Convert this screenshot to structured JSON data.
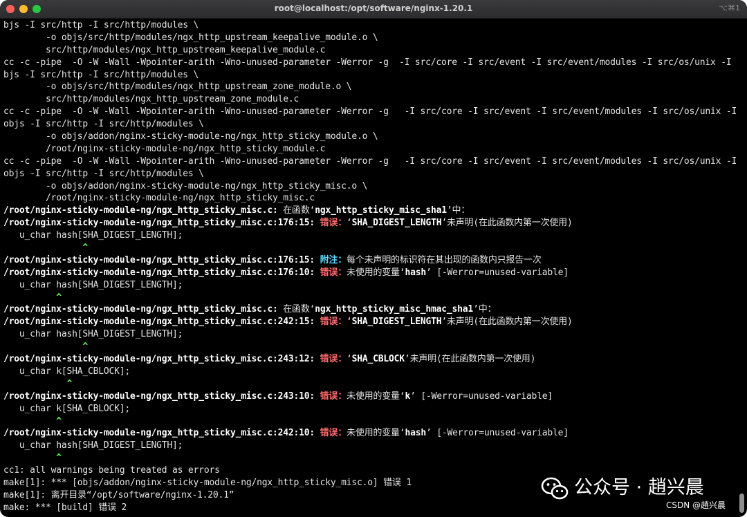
{
  "window": {
    "title": "root@localhost:/opt/software/nginx-1.20.1",
    "shortcut": "⌥⌘1"
  },
  "terminal": {
    "lines": [
      [
        {
          "t": "bjs -I src/http -I src/http/modules \\"
        }
      ],
      [
        {
          "t": "        -o objs/src/http/modules/ngx_http_upstream_keepalive_module.o \\"
        }
      ],
      [
        {
          "t": "        src/http/modules/ngx_http_upstream_keepalive_module.c"
        }
      ],
      [
        {
          "t": "cc -c -pipe  -O -W -Wall -Wpointer-arith -Wno-unused-parameter -Werror -g  -I src/core -I src/event -I src/event/modules -I src/os/unix -I o"
        }
      ],
      [
        {
          "t": "bjs -I src/http -I src/http/modules \\"
        }
      ],
      [
        {
          "t": "        -o objs/src/http/modules/ngx_http_upstream_zone_module.o \\"
        }
      ],
      [
        {
          "t": "        src/http/modules/ngx_http_upstream_zone_module.c"
        }
      ],
      [
        {
          "t": "cc -c -pipe  -O -W -Wall -Wpointer-arith -Wno-unused-parameter -Werror -g   -I src/core -I src/event -I src/event/modules -I src/os/unix -I"
        }
      ],
      [
        {
          "t": "objs -I src/http -I src/http/modules \\"
        }
      ],
      [
        {
          "t": "        -o objs/addon/nginx-sticky-module-ng/ngx_http_sticky_module.o \\"
        }
      ],
      [
        {
          "t": "        /root/nginx-sticky-module-ng/ngx_http_sticky_module.c"
        }
      ],
      [
        {
          "t": "cc -c -pipe  -O -W -Wall -Wpointer-arith -Wno-unused-parameter -Werror -g   -I src/core -I src/event -I src/event/modules -I src/os/unix -I"
        }
      ],
      [
        {
          "t": "objs -I src/http -I src/http/modules \\"
        }
      ],
      [
        {
          "t": "        -o objs/addon/nginx-sticky-module-ng/ngx_http_sticky_misc.o \\"
        }
      ],
      [
        {
          "t": "        /root/nginx-sticky-module-ng/ngx_http_sticky_misc.c"
        }
      ],
      [
        {
          "t": "/root/nginx-sticky-module-ng/ngx_http_sticky_misc.c:",
          "s": "b"
        },
        {
          "t": " 在函数‘"
        },
        {
          "t": "ngx_http_sticky_misc_sha1",
          "s": "b"
        },
        {
          "t": "’中："
        }
      ],
      [
        {
          "t": "/root/nginx-sticky-module-ng/ngx_http_sticky_misc.c:176:15:",
          "s": "b"
        },
        {
          "t": " "
        },
        {
          "t": "错误：",
          "s": "err"
        },
        {
          "t": "‘"
        },
        {
          "t": "SHA_DIGEST_LENGTH",
          "s": "b"
        },
        {
          "t": "’未声明(在此函数内第一次使用)"
        }
      ],
      [
        {
          "t": "   u_char hash[SHA_DIGEST_LENGTH];"
        }
      ],
      [
        {
          "t": "               ^",
          "s": "caret"
        }
      ],
      [
        {
          "t": "/root/nginx-sticky-module-ng/ngx_http_sticky_misc.c:176:15:",
          "s": "b"
        },
        {
          "t": " "
        },
        {
          "t": "附注：",
          "s": "note"
        },
        {
          "t": "每个未声明的标识符在其出现的函数内只报告一次"
        }
      ],
      [
        {
          "t": "/root/nginx-sticky-module-ng/ngx_http_sticky_misc.c:176:10:",
          "s": "b"
        },
        {
          "t": " "
        },
        {
          "t": "错误：",
          "s": "err"
        },
        {
          "t": "未使用的变量‘"
        },
        {
          "t": "hash",
          "s": "b"
        },
        {
          "t": "’ [-Werror=unused-variable]"
        }
      ],
      [
        {
          "t": "   u_char hash[SHA_DIGEST_LENGTH];"
        }
      ],
      [
        {
          "t": "          ^",
          "s": "caret"
        }
      ],
      [
        {
          "t": "/root/nginx-sticky-module-ng/ngx_http_sticky_misc.c:",
          "s": "b"
        },
        {
          "t": " 在函数‘"
        },
        {
          "t": "ngx_http_sticky_misc_hmac_sha1",
          "s": "b"
        },
        {
          "t": "’中："
        }
      ],
      [
        {
          "t": "/root/nginx-sticky-module-ng/ngx_http_sticky_misc.c:242:15:",
          "s": "b"
        },
        {
          "t": " "
        },
        {
          "t": "错误：",
          "s": "err"
        },
        {
          "t": "‘"
        },
        {
          "t": "SHA_DIGEST_LENGTH",
          "s": "b"
        },
        {
          "t": "’未声明(在此函数内第一次使用)"
        }
      ],
      [
        {
          "t": "   u_char hash[SHA_DIGEST_LENGTH];"
        }
      ],
      [
        {
          "t": "               ^",
          "s": "caret"
        }
      ],
      [
        {
          "t": "/root/nginx-sticky-module-ng/ngx_http_sticky_misc.c:243:12:",
          "s": "b"
        },
        {
          "t": " "
        },
        {
          "t": "错误：",
          "s": "err"
        },
        {
          "t": "‘"
        },
        {
          "t": "SHA_CBLOCK",
          "s": "b"
        },
        {
          "t": "’未声明(在此函数内第一次使用)"
        }
      ],
      [
        {
          "t": "   u_char k[SHA_CBLOCK];"
        }
      ],
      [
        {
          "t": "            ^",
          "s": "caret"
        }
      ],
      [
        {
          "t": "/root/nginx-sticky-module-ng/ngx_http_sticky_misc.c:243:10:",
          "s": "b"
        },
        {
          "t": " "
        },
        {
          "t": "错误：",
          "s": "err"
        },
        {
          "t": "未使用的变量‘"
        },
        {
          "t": "k",
          "s": "b"
        },
        {
          "t": "’ [-Werror=unused-variable]"
        }
      ],
      [
        {
          "t": "   u_char k[SHA_CBLOCK];"
        }
      ],
      [
        {
          "t": "          ^",
          "s": "caret"
        }
      ],
      [
        {
          "t": "/root/nginx-sticky-module-ng/ngx_http_sticky_misc.c:242:10:",
          "s": "b"
        },
        {
          "t": " "
        },
        {
          "t": "错误：",
          "s": "err"
        },
        {
          "t": "未使用的变量‘"
        },
        {
          "t": "hash",
          "s": "b"
        },
        {
          "t": "’ [-Werror=unused-variable]"
        }
      ],
      [
        {
          "t": "   u_char hash[SHA_DIGEST_LENGTH];"
        }
      ],
      [
        {
          "t": "          ^",
          "s": "caret"
        }
      ],
      [
        {
          "t": "cc1: all warnings being treated as errors"
        }
      ],
      [
        {
          "t": "make[1]: *** [objs/addon/nginx-sticky-module-ng/ngx_http_sticky_misc.o] 错误 1"
        }
      ],
      [
        {
          "t": "make[1]: 离开目录“/opt/software/nginx-1.20.1”"
        }
      ],
      [
        {
          "t": "make: *** [build] 错误 2"
        }
      ]
    ]
  },
  "watermark": {
    "icon": "wechat-icon",
    "text": "公众号 · 趙兴晨",
    "csdn": "CSDN @趙兴晨"
  }
}
